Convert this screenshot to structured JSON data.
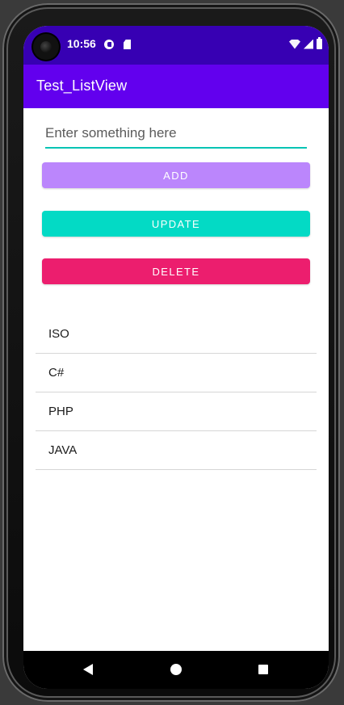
{
  "status_bar": {
    "time": "10:56",
    "icons": [
      "camera-icon",
      "c-notification-icon",
      "sd-card-icon",
      "wifi-icon",
      "signal-icon",
      "battery-icon"
    ]
  },
  "app_bar": {
    "title": "Test_ListView"
  },
  "input": {
    "placeholder": "Enter something here",
    "value": ""
  },
  "buttons": {
    "add": "ADD",
    "update": "UPDATE",
    "delete": "DELETE"
  },
  "colors": {
    "status_bar": "#3700b3",
    "app_bar": "#6200ee",
    "accent_teal": "#03dac5",
    "add_button": "#bb86fc",
    "delete_button": "#ec1e6e"
  },
  "list": {
    "items": [
      "ISO",
      "C#",
      "PHP",
      "JAVA"
    ]
  },
  "nav_bar": {
    "icons": [
      "back-icon",
      "home-icon",
      "recents-icon"
    ]
  }
}
